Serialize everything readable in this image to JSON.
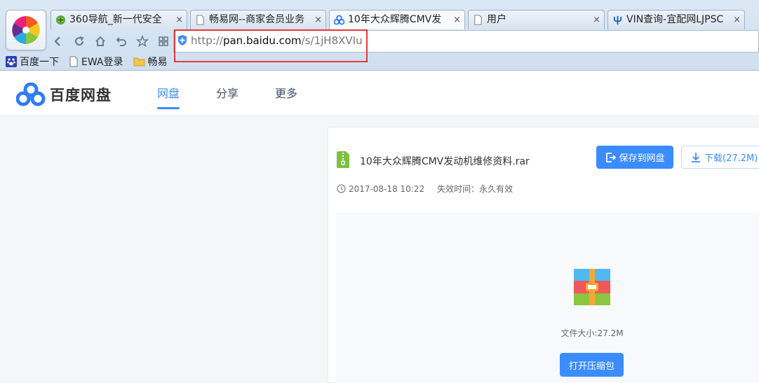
{
  "browser": {
    "tabs": [
      {
        "label": "360导航_新一代安全",
        "active": false
      },
      {
        "label": "畅易网--商家会员业务",
        "active": false
      },
      {
        "label": "10年大众辉腾CMV发",
        "active": true
      },
      {
        "label": "用户",
        "active": false
      },
      {
        "label": "VIN查询-宜配网LJPSC",
        "active": false
      }
    ],
    "close_glyph": "×",
    "url": {
      "scheme": "http://",
      "host": "pan.baidu.com",
      "path": "/s/1jH8XVIu"
    },
    "bookmarks": [
      {
        "label": "百度一下",
        "icon": "paw-icon"
      },
      {
        "label": "EWA登录",
        "icon": "page-icon"
      },
      {
        "label": "畅易",
        "icon": "folder-icon"
      }
    ]
  },
  "site": {
    "brand": "百度网盘",
    "nav": [
      {
        "label": "网盘",
        "active": true
      },
      {
        "label": "分享",
        "active": false
      },
      {
        "label": "更多",
        "active": false
      }
    ]
  },
  "file": {
    "name": "10年大众辉腾CMV发动机维修资料.rar",
    "save_label": "保存到网盘",
    "download_label": "下载(27.2M)",
    "date": "2017-08-18 10:22",
    "expire": "失效时间：永久有效",
    "size_label": "文件大小:27.2M",
    "open_label": "打开压缩包"
  },
  "colors": {
    "accent": "#3b8cff",
    "highlight_box": "#e53935",
    "file_green": "#7dc142"
  }
}
